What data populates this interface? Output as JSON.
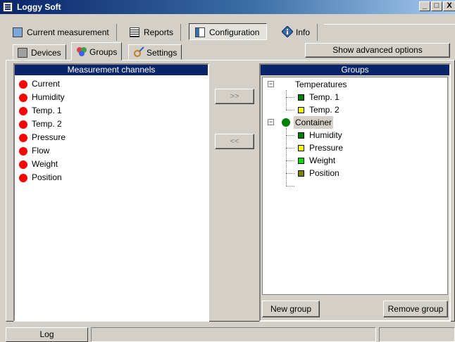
{
  "window": {
    "title": "Loggy Soft",
    "min": "_",
    "max": "□",
    "close": "X"
  },
  "toolbar": {
    "tabs": [
      {
        "label": "Current measurement",
        "icon": "monitor-icon"
      },
      {
        "label": "Reports",
        "icon": "report-icon"
      },
      {
        "label": "Configuration",
        "icon": "configuration-icon",
        "active": true
      },
      {
        "label": "Info",
        "icon": "info-icon"
      }
    ]
  },
  "subtabs": [
    {
      "label": "Devices",
      "icon": "devices-icon"
    },
    {
      "label": "Groups",
      "icon": "groups-icon",
      "active": true
    },
    {
      "label": "Settings",
      "icon": "settings-icon"
    }
  ],
  "advanced_button": "Show advanced options",
  "channels": {
    "header": "Measurement channels",
    "items": [
      {
        "label": "Current",
        "color": "#ff0000"
      },
      {
        "label": "Humidity",
        "color": "#ff0000"
      },
      {
        "label": "Temp. 1",
        "color": "#ff0000"
      },
      {
        "label": "Temp. 2",
        "color": "#ff0000"
      },
      {
        "label": "Pressure",
        "color": "#ff0000"
      },
      {
        "label": "Flow",
        "color": "#ff0000"
      },
      {
        "label": "Weight",
        "color": "#ff0000"
      },
      {
        "label": "Position",
        "color": "#ff0000"
      }
    ]
  },
  "move_buttons": {
    "add": ">>",
    "remove": "<<"
  },
  "groups": {
    "header": "Groups",
    "tree": [
      {
        "label": "Temperatures",
        "color": "#ff0000",
        "children": [
          {
            "label": "Temp. 1",
            "color": "#008000"
          },
          {
            "label": "Temp. 2",
            "color": "#ffff00"
          }
        ]
      },
      {
        "label": "Container",
        "color": "#008000",
        "selected": true,
        "children": [
          {
            "label": "Humidity",
            "color": "#008000"
          },
          {
            "label": "Pressure",
            "color": "#ffff00"
          },
          {
            "label": "Weight",
            "color": "#00e000"
          },
          {
            "label": "Position",
            "color": "#808000"
          }
        ]
      }
    ],
    "new_button": "New group",
    "remove_button": "Remove group"
  },
  "statusbar": {
    "log_label": "Log"
  }
}
